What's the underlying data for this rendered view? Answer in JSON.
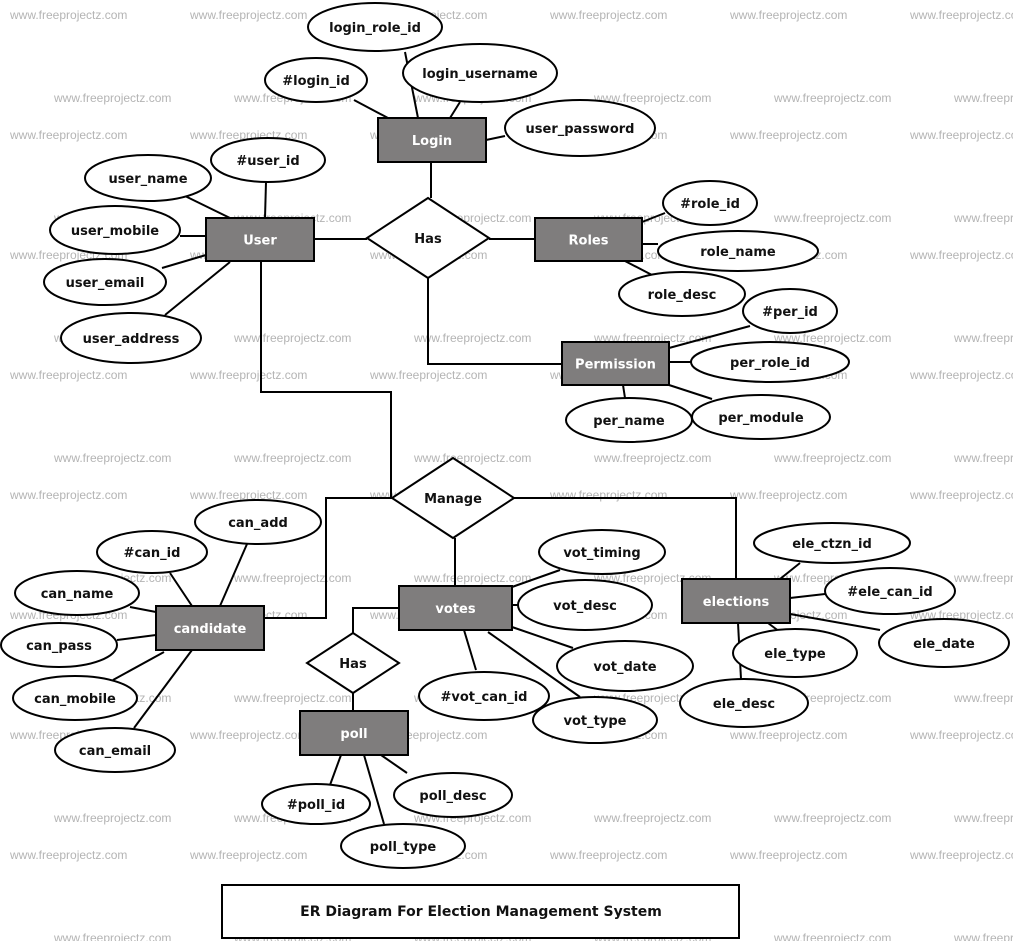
{
  "diagram": {
    "title": "ER Diagram For Election Management System",
    "watermark": "www.freeprojectz.com",
    "colors": {
      "entity_fill": "#7f7d7d",
      "entity_text": "#ffffff",
      "stroke": "#000000",
      "watermark": "#b4b4b4"
    },
    "entities": {
      "login": "Login",
      "user": "User",
      "roles": "Roles",
      "permission": "Permission",
      "candidate": "candidate",
      "votes": "votes",
      "elections": "elections",
      "poll": "poll"
    },
    "relationships": {
      "has_top": "Has",
      "manage": "Manage",
      "has_poll": "Has"
    },
    "attributes": {
      "login": [
        "login_role_id",
        "#login_id",
        "login_username",
        "user_password"
      ],
      "user": [
        "#user_id",
        "user_name",
        "user_mobile",
        "user_email",
        "user_address"
      ],
      "roles": [
        "#role_id",
        "role_name",
        "role_desc"
      ],
      "permission": [
        "#per_id",
        "per_role_id",
        "per_name",
        "per_module"
      ],
      "candidate": [
        "can_add",
        "#can_id",
        "can_name",
        "can_pass",
        "can_mobile",
        "can_email"
      ],
      "votes": [
        "vot_timing",
        "vot_desc",
        "vot_date",
        "#vot_can_id",
        "vot_type"
      ],
      "elections": [
        "ele_ctzn_id",
        "#ele_can_id",
        "ele_date",
        "ele_type",
        "ele_desc"
      ],
      "poll": [
        "#poll_id",
        "poll_desc",
        "poll_type"
      ]
    },
    "connections": [
      [
        "login",
        "has_top"
      ],
      [
        "user",
        "has_top"
      ],
      [
        "roles",
        "has_top"
      ],
      [
        "permission",
        "has_top"
      ],
      [
        "user",
        "manage"
      ],
      [
        "candidate",
        "manage"
      ],
      [
        "votes",
        "manage"
      ],
      [
        "elections",
        "manage"
      ],
      [
        "votes",
        "has_poll"
      ],
      [
        "poll",
        "has_poll"
      ]
    ]
  }
}
